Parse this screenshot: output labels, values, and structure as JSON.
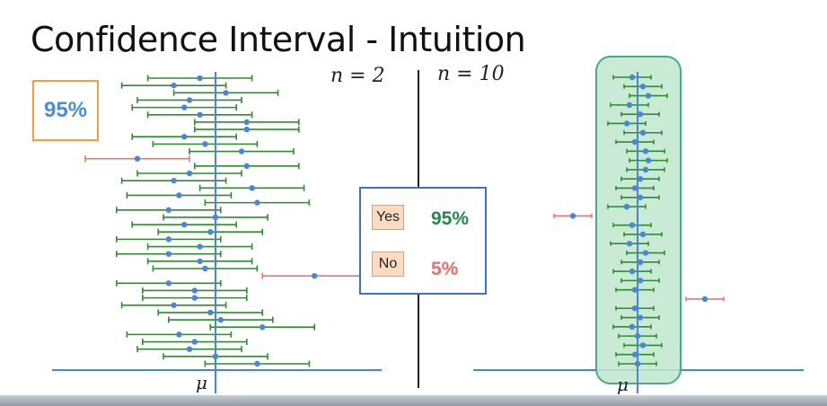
{
  "title": "Confidence Interval - Intuition",
  "confidence_label": "95%",
  "left_panel": {
    "n_label": "n = 2",
    "mu_label": "μ"
  },
  "right_panel": {
    "n_label": "n = 10",
    "mu_label": "μ"
  },
  "legend": {
    "yes_label": "Yes",
    "yes_pct": "95%",
    "no_label": "No",
    "no_pct": "5%"
  },
  "colors": {
    "contains_mean": "#2e8b2e",
    "misses_mean": "#e07a7a",
    "point": "#4a86d8",
    "mean_line": "#4a86d8",
    "highlight_fill": "#bfe6cc",
    "highlight_border": "#4aaa88",
    "legend_border": "#3b6fd0",
    "conf_box_border": "#f0a040",
    "yes_pct": "#1f8a4a",
    "no_pct": "#ee6b6b"
  },
  "chart_data": {
    "type": "scatter",
    "description_series": [
      {
        "name": "n = 2",
        "intervals": [
          {
            "center": -0.3,
            "half": 1.0
          },
          {
            "center": -0.8,
            "half": 1.0
          },
          {
            "center": 0.2,
            "half": 1.0
          },
          {
            "center": -0.5,
            "half": 1.0
          },
          {
            "center": -0.6,
            "half": 1.0
          },
          {
            "center": -0.3,
            "half": 1.0
          },
          {
            "center": 0.6,
            "half": 1.0
          },
          {
            "center": 0.6,
            "half": 1.0
          },
          {
            "center": -0.6,
            "half": 1.0
          },
          {
            "center": -0.2,
            "half": 1.0
          },
          {
            "center": 0.5,
            "half": 1.0
          },
          {
            "center": -1.5,
            "half": 1.0,
            "miss": true
          },
          {
            "center": 0.6,
            "half": 1.0
          },
          {
            "center": -0.5,
            "half": 1.0
          },
          {
            "center": -0.8,
            "half": 1.0
          },
          {
            "center": 0.7,
            "half": 1.0
          },
          {
            "center": -0.7,
            "half": 1.0
          },
          {
            "center": 0.8,
            "half": 1.0
          },
          {
            "center": -0.9,
            "half": 1.0
          },
          {
            "center": 0.0,
            "half": 1.0
          },
          {
            "center": -0.6,
            "half": 1.0
          },
          {
            "center": -0.1,
            "half": 1.0
          },
          {
            "center": -0.9,
            "half": 1.0
          },
          {
            "center": -0.3,
            "half": 1.0
          },
          {
            "center": -0.9,
            "half": 1.0
          },
          {
            "center": -0.3,
            "half": 1.0
          },
          {
            "center": -0.2,
            "half": 1.0
          },
          {
            "center": 1.9,
            "half": 1.0,
            "miss": true
          },
          {
            "center": -0.9,
            "half": 1.0
          },
          {
            "center": -0.4,
            "half": 1.0
          },
          {
            "center": -0.4,
            "half": 1.0
          },
          {
            "center": -0.8,
            "half": 1.0
          },
          {
            "center": -0.1,
            "half": 1.0
          },
          {
            "center": 0.1,
            "half": 1.0
          },
          {
            "center": 0.9,
            "half": 1.0
          },
          {
            "center": -0.7,
            "half": 1.0
          },
          {
            "center": -0.4,
            "half": 1.0
          },
          {
            "center": -0.5,
            "half": 1.0
          },
          {
            "center": 0.0,
            "half": 1.0
          },
          {
            "center": 0.8,
            "half": 1.0
          }
        ]
      },
      {
        "name": "n = 10",
        "intervals": [
          {
            "center": -0.1,
            "half": 0.35
          },
          {
            "center": 0.1,
            "half": 0.35
          },
          {
            "center": 0.2,
            "half": 0.35
          },
          {
            "center": -0.15,
            "half": 0.35
          },
          {
            "center": 0.05,
            "half": 0.35
          },
          {
            "center": -0.2,
            "half": 0.35
          },
          {
            "center": 0.1,
            "half": 0.35
          },
          {
            "center": -0.05,
            "half": 0.35
          },
          {
            "center": 0.15,
            "half": 0.35
          },
          {
            "center": 0.2,
            "half": 0.35
          },
          {
            "center": 0.15,
            "half": 0.35
          },
          {
            "center": 0.05,
            "half": 0.35
          },
          {
            "center": -0.05,
            "half": 0.35
          },
          {
            "center": 0.05,
            "half": 0.35
          },
          {
            "center": -0.2,
            "half": 0.35
          },
          {
            "center": -1.2,
            "half": 0.35,
            "miss": true
          },
          {
            "center": -0.1,
            "half": 0.35
          },
          {
            "center": 0.1,
            "half": 0.35
          },
          {
            "center": -0.15,
            "half": 0.35
          },
          {
            "center": 0.15,
            "half": 0.35
          },
          {
            "center": 0.05,
            "half": 0.35
          },
          {
            "center": -0.1,
            "half": 0.35
          },
          {
            "center": 0.05,
            "half": 0.35
          },
          {
            "center": -0.05,
            "half": 0.35
          },
          {
            "center": 1.25,
            "half": 0.35,
            "miss": true
          },
          {
            "center": -0.05,
            "half": 0.35
          },
          {
            "center": 0.05,
            "half": 0.35
          },
          {
            "center": -0.1,
            "half": 0.35
          },
          {
            "center": 0.0,
            "half": 0.35
          },
          {
            "center": 0.1,
            "half": 0.35
          },
          {
            "center": -0.05,
            "half": 0.35
          },
          {
            "center": 0.0,
            "half": 0.35
          }
        ]
      }
    ]
  }
}
